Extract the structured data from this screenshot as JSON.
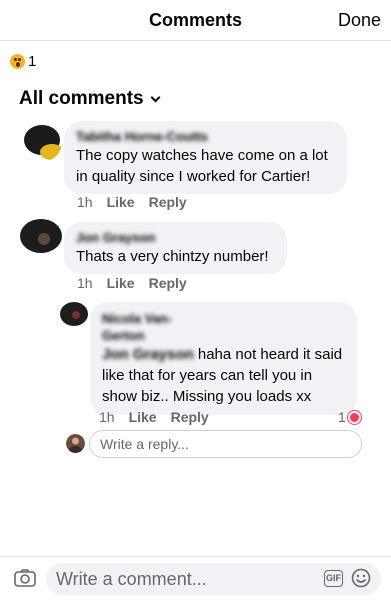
{
  "header": {
    "title": "Comments",
    "done_label": "Done"
  },
  "reactions": {
    "icon": "wow-emoji-icon",
    "count": "1"
  },
  "filter": {
    "label": "All comments"
  },
  "comments": [
    {
      "author": "Tabitha Horne-Coutts",
      "text": "The copy watches have come on a lot in quality since I worked for Cartier!",
      "time": "1h",
      "like_label": "Like",
      "reply_label": "Reply"
    },
    {
      "author": "Jon Grayson",
      "text": "Thats a very chintzy number!",
      "time": "1h",
      "like_label": "Like",
      "reply_label": "Reply"
    }
  ],
  "reply": {
    "author": "Nicola Van-Gerton",
    "mention": "Jon Grayson",
    "text": "haha not heard it said like that for years can tell you in show biz..  Missing you loads xx",
    "time": "1h",
    "like_label": "Like",
    "reply_label": "Reply",
    "reaction_count": "1",
    "reaction_icon": "love-heart-icon"
  },
  "reply_box": {
    "placeholder": "Write a reply..."
  },
  "composer": {
    "placeholder": "Write a comment...",
    "gif_label": "GIF"
  },
  "colors": {
    "bubble": "#f0f2f5",
    "meta_text": "#65676b",
    "heart": "#f33e58",
    "wow": "#f7b125"
  }
}
